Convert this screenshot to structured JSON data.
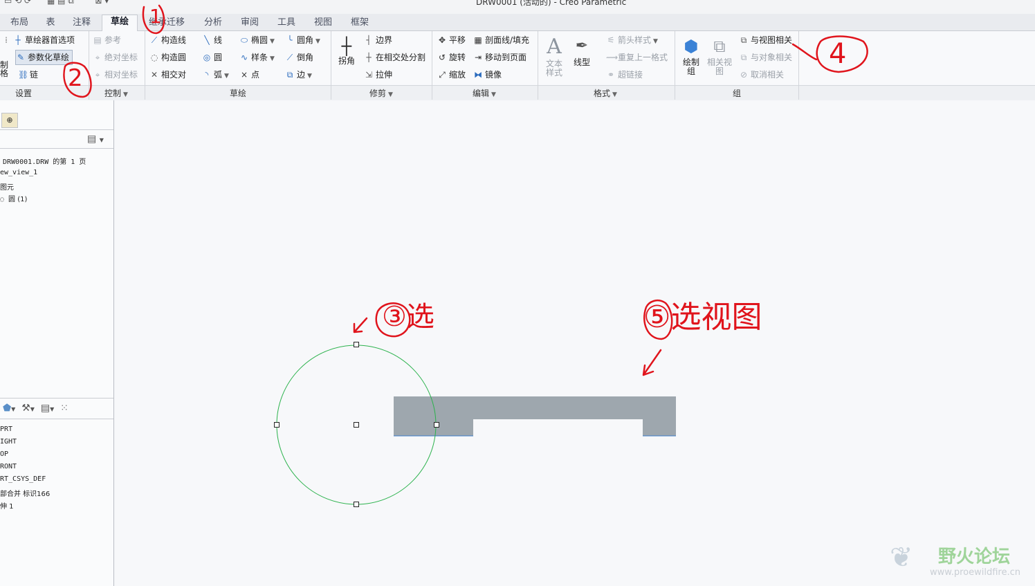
{
  "window": {
    "title": "DRW0001 (活动的) - Creo Parametric"
  },
  "tabs": [
    {
      "label": "布局",
      "active": false
    },
    {
      "label": "表",
      "active": false
    },
    {
      "label": "注释",
      "active": false
    },
    {
      "label": "草绘",
      "active": true
    },
    {
      "label": "继承迁移",
      "active": false
    },
    {
      "label": "分析",
      "active": false
    },
    {
      "label": "审阅",
      "active": false
    },
    {
      "label": "工具",
      "active": false
    },
    {
      "label": "视图",
      "active": false
    },
    {
      "label": "框架",
      "active": false
    }
  ],
  "ribbon": {
    "settings": {
      "label": "设置",
      "sketch_prefs": "草绘器首选项",
      "param_sketch": "参数化草绘",
      "chain": "链",
      "clip_left1": "制",
      "clip_left2": "格"
    },
    "control": {
      "label": "控制",
      "reference": "参考",
      "abs_coord": "绝对坐标",
      "rel_coord": "相对坐标"
    },
    "sketch": {
      "label": "草绘",
      "const_line": "构造线",
      "const_circle": "构造圆",
      "intersect": "相交对",
      "line": "线",
      "circle": "圆",
      "arc": "弧",
      "ellipse": "椭圆",
      "spline": "样条",
      "point": "点",
      "fillet": "圆角",
      "chamfer": "倒角",
      "edge": "边"
    },
    "trim": {
      "label": "修剪",
      "corner": "拐角",
      "boundary": "边界",
      "split_at_intersect": "在相交处分割",
      "stretch": "拉伸"
    },
    "edit": {
      "label": "编辑",
      "translate": "平移",
      "rotate": "旋转",
      "scale": "缩放",
      "hatch": "剖面线/填充",
      "move_to_page": "移动到页面",
      "mirror": "镜像"
    },
    "format": {
      "label": "格式",
      "text_style": "文本样式",
      "line_style": "线型",
      "arrow_style": "箭头样式",
      "repeat_format": "重复上一格式",
      "hyperlink": "超链接"
    },
    "group": {
      "label": "组",
      "draw_group": "绘制组",
      "related_view": "相关视图",
      "relate_to_view": "与视图相关",
      "relate_to_object": "与对象相关",
      "unrelate": "取消相关"
    }
  },
  "left_panel": {
    "tree_top": [
      "DRW0001.DRW 的第 1 页",
      "ew_view_1",
      "图元",
      "圆 (1)"
    ],
    "tree_bottom": [
      "PRT",
      "IGHT",
      "OP",
      "RONT",
      "RT_CSYS_DEF",
      "部合并 标识166",
      "伸 1"
    ]
  },
  "annotations": {
    "n1": "1",
    "n2": "2",
    "n3": "③选",
    "n4": "4",
    "n5": "⑤选视图"
  },
  "watermark": {
    "title": "野火论坛",
    "url": "www.proewildfire.cn"
  },
  "colors": {
    "accent": "#2a6bbd",
    "annotation": "#e0141c",
    "circle": "#2bb24c",
    "view_fill": "#9ea7ae"
  }
}
